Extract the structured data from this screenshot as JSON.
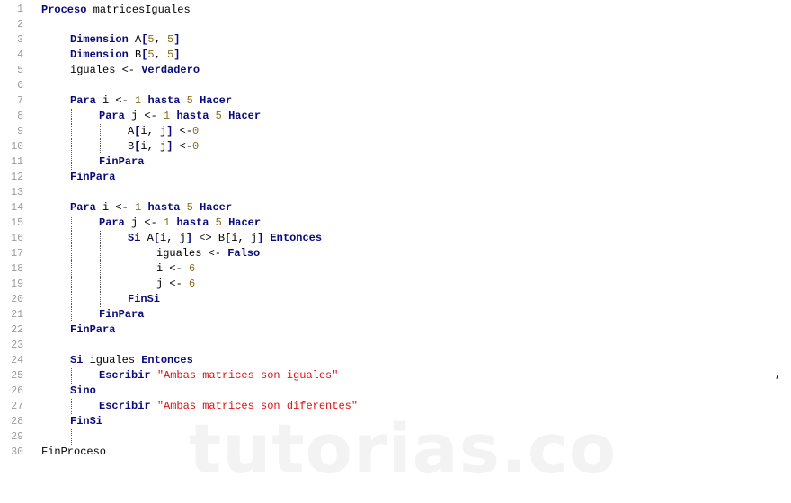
{
  "editor": {
    "lines": [
      {
        "n": "1",
        "indent": 0,
        "guides": [],
        "tokens": [
          [
            "kw",
            "Proceso"
          ],
          [
            "txt",
            " matricesIguales"
          ]
        ],
        "cursor": true
      },
      {
        "n": "2",
        "indent": 0,
        "guides": [],
        "tokens": []
      },
      {
        "n": "3",
        "indent": 1,
        "guides": [],
        "tokens": [
          [
            "kw",
            "Dimension"
          ],
          [
            "txt",
            " A"
          ],
          [
            "kw",
            "["
          ],
          [
            "num",
            "5"
          ],
          [
            "txt",
            ", "
          ],
          [
            "num",
            "5"
          ],
          [
            "kw",
            "]"
          ]
        ]
      },
      {
        "n": "4",
        "indent": 1,
        "guides": [],
        "tokens": [
          [
            "kw",
            "Dimension"
          ],
          [
            "txt",
            " B"
          ],
          [
            "kw",
            "["
          ],
          [
            "num",
            "5"
          ],
          [
            "txt",
            ", "
          ],
          [
            "num",
            "5"
          ],
          [
            "kw",
            "]"
          ]
        ]
      },
      {
        "n": "5",
        "indent": 1,
        "guides": [],
        "tokens": [
          [
            "txt",
            "iguales <- "
          ],
          [
            "kw",
            "Verdadero"
          ]
        ]
      },
      {
        "n": "6",
        "indent": 0,
        "guides": [],
        "tokens": []
      },
      {
        "n": "7",
        "indent": 1,
        "guides": [],
        "tokens": [
          [
            "kw",
            "Para"
          ],
          [
            "txt",
            " i <- "
          ],
          [
            "num",
            "1"
          ],
          [
            "txt",
            " "
          ],
          [
            "kw",
            "hasta"
          ],
          [
            "txt",
            " "
          ],
          [
            "num",
            "5"
          ],
          [
            "txt",
            " "
          ],
          [
            "kw",
            "Hacer"
          ]
        ]
      },
      {
        "n": "8",
        "indent": 2,
        "guides": [
          1
        ],
        "tokens": [
          [
            "kw",
            "Para"
          ],
          [
            "txt",
            " j <- "
          ],
          [
            "num",
            "1"
          ],
          [
            "txt",
            " "
          ],
          [
            "kw",
            "hasta"
          ],
          [
            "txt",
            " "
          ],
          [
            "num",
            "5"
          ],
          [
            "txt",
            " "
          ],
          [
            "kw",
            "Hacer"
          ]
        ]
      },
      {
        "n": "9",
        "indent": 3,
        "guides": [
          1,
          2
        ],
        "tokens": [
          [
            "txt",
            "A"
          ],
          [
            "kw",
            "["
          ],
          [
            "txt",
            "i, j"
          ],
          [
            "kw",
            "]"
          ],
          [
            "txt",
            " <-"
          ],
          [
            "num",
            "0"
          ]
        ]
      },
      {
        "n": "10",
        "indent": 3,
        "guides": [
          1,
          2
        ],
        "tokens": [
          [
            "txt",
            "B"
          ],
          [
            "kw",
            "["
          ],
          [
            "txt",
            "i, j"
          ],
          [
            "kw",
            "]"
          ],
          [
            "txt",
            " <-"
          ],
          [
            "num",
            "0"
          ]
        ]
      },
      {
        "n": "11",
        "indent": 2,
        "guides": [
          1
        ],
        "tokens": [
          [
            "kw",
            "FinPara"
          ]
        ]
      },
      {
        "n": "12",
        "indent": 1,
        "guides": [],
        "tokens": [
          [
            "kw",
            "FinPara"
          ]
        ]
      },
      {
        "n": "13",
        "indent": 0,
        "guides": [],
        "tokens": []
      },
      {
        "n": "14",
        "indent": 1,
        "guides": [],
        "tokens": [
          [
            "kw",
            "Para"
          ],
          [
            "txt",
            " i <- "
          ],
          [
            "num",
            "1"
          ],
          [
            "txt",
            " "
          ],
          [
            "kw",
            "hasta"
          ],
          [
            "txt",
            " "
          ],
          [
            "num",
            "5"
          ],
          [
            "txt",
            " "
          ],
          [
            "kw",
            "Hacer"
          ]
        ]
      },
      {
        "n": "15",
        "indent": 2,
        "guides": [
          1
        ],
        "tokens": [
          [
            "kw",
            "Para"
          ],
          [
            "txt",
            " j <- "
          ],
          [
            "num",
            "1"
          ],
          [
            "txt",
            " "
          ],
          [
            "kw",
            "hasta"
          ],
          [
            "txt",
            " "
          ],
          [
            "num",
            "5"
          ],
          [
            "txt",
            " "
          ],
          [
            "kw",
            "Hacer"
          ]
        ]
      },
      {
        "n": "16",
        "indent": 3,
        "guides": [
          1,
          2
        ],
        "tokens": [
          [
            "kw",
            "Si"
          ],
          [
            "txt",
            " A"
          ],
          [
            "kw",
            "["
          ],
          [
            "txt",
            "i, j"
          ],
          [
            "kw",
            "]"
          ],
          [
            "txt",
            " <> B"
          ],
          [
            "kw",
            "["
          ],
          [
            "txt",
            "i, j"
          ],
          [
            "kw",
            "]"
          ],
          [
            "txt",
            " "
          ],
          [
            "kw",
            "Entonces"
          ]
        ]
      },
      {
        "n": "17",
        "indent": 4,
        "guides": [
          1,
          2,
          3
        ],
        "tokens": [
          [
            "txt",
            "iguales <- "
          ],
          [
            "kw",
            "Falso"
          ]
        ]
      },
      {
        "n": "18",
        "indent": 4,
        "guides": [
          1,
          2,
          3
        ],
        "tokens": [
          [
            "txt",
            "i <- "
          ],
          [
            "num",
            "6"
          ]
        ]
      },
      {
        "n": "19",
        "indent": 4,
        "guides": [
          1,
          2,
          3
        ],
        "tokens": [
          [
            "txt",
            "j <- "
          ],
          [
            "num",
            "6"
          ]
        ]
      },
      {
        "n": "20",
        "indent": 3,
        "guides": [
          1,
          2
        ],
        "tokens": [
          [
            "kw",
            "FinSi"
          ]
        ]
      },
      {
        "n": "21",
        "indent": 2,
        "guides": [
          1
        ],
        "tokens": [
          [
            "kw",
            "FinPara"
          ]
        ]
      },
      {
        "n": "22",
        "indent": 1,
        "guides": [],
        "tokens": [
          [
            "kw",
            "FinPara"
          ]
        ]
      },
      {
        "n": "23",
        "indent": 0,
        "guides": [],
        "tokens": []
      },
      {
        "n": "24",
        "indent": 1,
        "guides": [],
        "tokens": [
          [
            "kw",
            "Si"
          ],
          [
            "txt",
            " iguales "
          ],
          [
            "kw",
            "Entonces"
          ]
        ]
      },
      {
        "n": "25",
        "indent": 2,
        "guides": [
          1
        ],
        "tokens": [
          [
            "kw",
            "Escribir"
          ],
          [
            "txt",
            " "
          ],
          [
            "str",
            "\"Ambas matrices son iguales\""
          ]
        ]
      },
      {
        "n": "26",
        "indent": 1,
        "guides": [],
        "tokens": [
          [
            "kw",
            "Sino"
          ]
        ]
      },
      {
        "n": "27",
        "indent": 2,
        "guides": [
          1
        ],
        "tokens": [
          [
            "kw",
            "Escribir"
          ],
          [
            "txt",
            " "
          ],
          [
            "str",
            "\"Ambas matrices son diferentes\""
          ]
        ]
      },
      {
        "n": "28",
        "indent": 1,
        "guides": [],
        "tokens": [
          [
            "kw",
            "FinSi"
          ]
        ]
      },
      {
        "n": "29",
        "indent": 1,
        "guides": [
          1
        ],
        "tokens": []
      },
      {
        "n": "30",
        "indent": 0,
        "guides": [],
        "tokens": [
          [
            "txt",
            "FinProceso"
          ]
        ]
      }
    ]
  },
  "watermark": "tutorias.co",
  "stray_mark": ","
}
